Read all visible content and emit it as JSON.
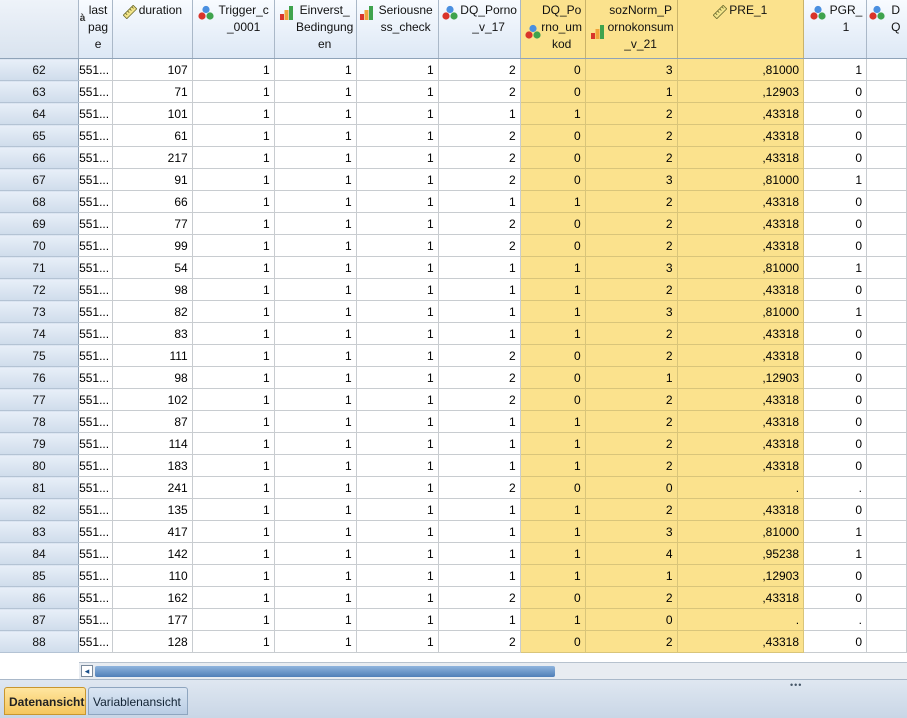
{
  "columns": [
    {
      "key": "rownum",
      "label": "",
      "icon": "none"
    },
    {
      "key": "lastpage",
      "label": "last page",
      "icon": "string-icon"
    },
    {
      "key": "duration",
      "label": "duration",
      "icon": "scale-ruler-icon"
    },
    {
      "key": "trigger",
      "label": "Trigger_c_0001",
      "icon": "nominal-icon"
    },
    {
      "key": "einverst",
      "label": "Einverst_Bedingungen",
      "icon": "ordinal-icon"
    },
    {
      "key": "serious",
      "label": "Seriousness_check",
      "icon": "ordinal-icon"
    },
    {
      "key": "dqporno",
      "label": "DQ_Porno_v_17",
      "icon": "nominal-icon"
    },
    {
      "key": "dqpu",
      "label": "DQ_Porno_umkod",
      "icon": "nominal-icon",
      "highlight": true
    },
    {
      "key": "soznorm",
      "label": "sozNorm_Pornokonsum_v_21",
      "icon": "ordinal-icon",
      "highlight": true
    },
    {
      "key": "pre1",
      "label": "PRE_1",
      "icon": "scale-ruler-icon",
      "highlight": true
    },
    {
      "key": "pgr1",
      "label": "PGR_1",
      "icon": "nominal-icon"
    },
    {
      "key": "dq",
      "label": "DQ",
      "icon": "nominal-icon"
    }
  ],
  "rows": [
    {
      "n": "62",
      "lp": "551...",
      "d": "107",
      "t": "1",
      "e": "1",
      "s": "1",
      "dp": "2",
      "dpu": "0",
      "sn": "3",
      "pre": ",81000",
      "pgr": "1"
    },
    {
      "n": "63",
      "lp": "551...",
      "d": "71",
      "t": "1",
      "e": "1",
      "s": "1",
      "dp": "2",
      "dpu": "0",
      "sn": "1",
      "pre": ",12903",
      "pgr": "0"
    },
    {
      "n": "64",
      "lp": "551...",
      "d": "101",
      "t": "1",
      "e": "1",
      "s": "1",
      "dp": "1",
      "dpu": "1",
      "sn": "2",
      "pre": ",43318",
      "pgr": "0"
    },
    {
      "n": "65",
      "lp": "551...",
      "d": "61",
      "t": "1",
      "e": "1",
      "s": "1",
      "dp": "2",
      "dpu": "0",
      "sn": "2",
      "pre": ",43318",
      "pgr": "0"
    },
    {
      "n": "66",
      "lp": "551...",
      "d": "217",
      "t": "1",
      "e": "1",
      "s": "1",
      "dp": "2",
      "dpu": "0",
      "sn": "2",
      "pre": ",43318",
      "pgr": "0"
    },
    {
      "n": "67",
      "lp": "551...",
      "d": "91",
      "t": "1",
      "e": "1",
      "s": "1",
      "dp": "2",
      "dpu": "0",
      "sn": "3",
      "pre": ",81000",
      "pgr": "1"
    },
    {
      "n": "68",
      "lp": "551...",
      "d": "66",
      "t": "1",
      "e": "1",
      "s": "1",
      "dp": "1",
      "dpu": "1",
      "sn": "2",
      "pre": ",43318",
      "pgr": "0"
    },
    {
      "n": "69",
      "lp": "551...",
      "d": "77",
      "t": "1",
      "e": "1",
      "s": "1",
      "dp": "2",
      "dpu": "0",
      "sn": "2",
      "pre": ",43318",
      "pgr": "0"
    },
    {
      "n": "70",
      "lp": "551...",
      "d": "99",
      "t": "1",
      "e": "1",
      "s": "1",
      "dp": "2",
      "dpu": "0",
      "sn": "2",
      "pre": ",43318",
      "pgr": "0"
    },
    {
      "n": "71",
      "lp": "551...",
      "d": "54",
      "t": "1",
      "e": "1",
      "s": "1",
      "dp": "1",
      "dpu": "1",
      "sn": "3",
      "pre": ",81000",
      "pgr": "1"
    },
    {
      "n": "72",
      "lp": "551...",
      "d": "98",
      "t": "1",
      "e": "1",
      "s": "1",
      "dp": "1",
      "dpu": "1",
      "sn": "2",
      "pre": ",43318",
      "pgr": "0"
    },
    {
      "n": "73",
      "lp": "551...",
      "d": "82",
      "t": "1",
      "e": "1",
      "s": "1",
      "dp": "1",
      "dpu": "1",
      "sn": "3",
      "pre": ",81000",
      "pgr": "1"
    },
    {
      "n": "74",
      "lp": "551...",
      "d": "83",
      "t": "1",
      "e": "1",
      "s": "1",
      "dp": "1",
      "dpu": "1",
      "sn": "2",
      "pre": ",43318",
      "pgr": "0"
    },
    {
      "n": "75",
      "lp": "551...",
      "d": "111",
      "t": "1",
      "e": "1",
      "s": "1",
      "dp": "2",
      "dpu": "0",
      "sn": "2",
      "pre": ",43318",
      "pgr": "0"
    },
    {
      "n": "76",
      "lp": "551...",
      "d": "98",
      "t": "1",
      "e": "1",
      "s": "1",
      "dp": "2",
      "dpu": "0",
      "sn": "1",
      "pre": ",12903",
      "pgr": "0"
    },
    {
      "n": "77",
      "lp": "551...",
      "d": "102",
      "t": "1",
      "e": "1",
      "s": "1",
      "dp": "2",
      "dpu": "0",
      "sn": "2",
      "pre": ",43318",
      "pgr": "0"
    },
    {
      "n": "78",
      "lp": "551...",
      "d": "87",
      "t": "1",
      "e": "1",
      "s": "1",
      "dp": "1",
      "dpu": "1",
      "sn": "2",
      "pre": ",43318",
      "pgr": "0"
    },
    {
      "n": "79",
      "lp": "551...",
      "d": "114",
      "t": "1",
      "e": "1",
      "s": "1",
      "dp": "1",
      "dpu": "1",
      "sn": "2",
      "pre": ",43318",
      "pgr": "0"
    },
    {
      "n": "80",
      "lp": "551...",
      "d": "183",
      "t": "1",
      "e": "1",
      "s": "1",
      "dp": "1",
      "dpu": "1",
      "sn": "2",
      "pre": ",43318",
      "pgr": "0"
    },
    {
      "n": "81",
      "lp": "551...",
      "d": "241",
      "t": "1",
      "e": "1",
      "s": "1",
      "dp": "2",
      "dpu": "0",
      "sn": "0",
      "pre": ".",
      "pgr": "."
    },
    {
      "n": "82",
      "lp": "551...",
      "d": "135",
      "t": "1",
      "e": "1",
      "s": "1",
      "dp": "1",
      "dpu": "1",
      "sn": "2",
      "pre": ",43318",
      "pgr": "0"
    },
    {
      "n": "83",
      "lp": "551...",
      "d": "417",
      "t": "1",
      "e": "1",
      "s": "1",
      "dp": "1",
      "dpu": "1",
      "sn": "3",
      "pre": ",81000",
      "pgr": "1"
    },
    {
      "n": "84",
      "lp": "551...",
      "d": "142",
      "t": "1",
      "e": "1",
      "s": "1",
      "dp": "1",
      "dpu": "1",
      "sn": "4",
      "pre": ",95238",
      "pgr": "1"
    },
    {
      "n": "85",
      "lp": "551...",
      "d": "110",
      "t": "1",
      "e": "1",
      "s": "1",
      "dp": "1",
      "dpu": "1",
      "sn": "1",
      "pre": ",12903",
      "pgr": "0"
    },
    {
      "n": "86",
      "lp": "551...",
      "d": "162",
      "t": "1",
      "e": "1",
      "s": "1",
      "dp": "2",
      "dpu": "0",
      "sn": "2",
      "pre": ",43318",
      "pgr": "0"
    },
    {
      "n": "87",
      "lp": "551...",
      "d": "177",
      "t": "1",
      "e": "1",
      "s": "1",
      "dp": "1",
      "dpu": "1",
      "sn": "0",
      "pre": ".",
      "pgr": "."
    },
    {
      "n": "88",
      "lp": "551...",
      "d": "128",
      "t": "1",
      "e": "1",
      "s": "1",
      "dp": "2",
      "dpu": "0",
      "sn": "2",
      "pre": ",43318",
      "pgr": "0"
    }
  ],
  "tabs": {
    "data_view": "Datenansicht",
    "variable_view": "Variablenansicht"
  },
  "scrollbar": {
    "left_arrow": "◂"
  },
  "status": {
    "grip": "•••"
  },
  "colors": {
    "highlight": "#fbe28d",
    "header": "#dde8f5",
    "active_tab": "#f5c65c"
  }
}
